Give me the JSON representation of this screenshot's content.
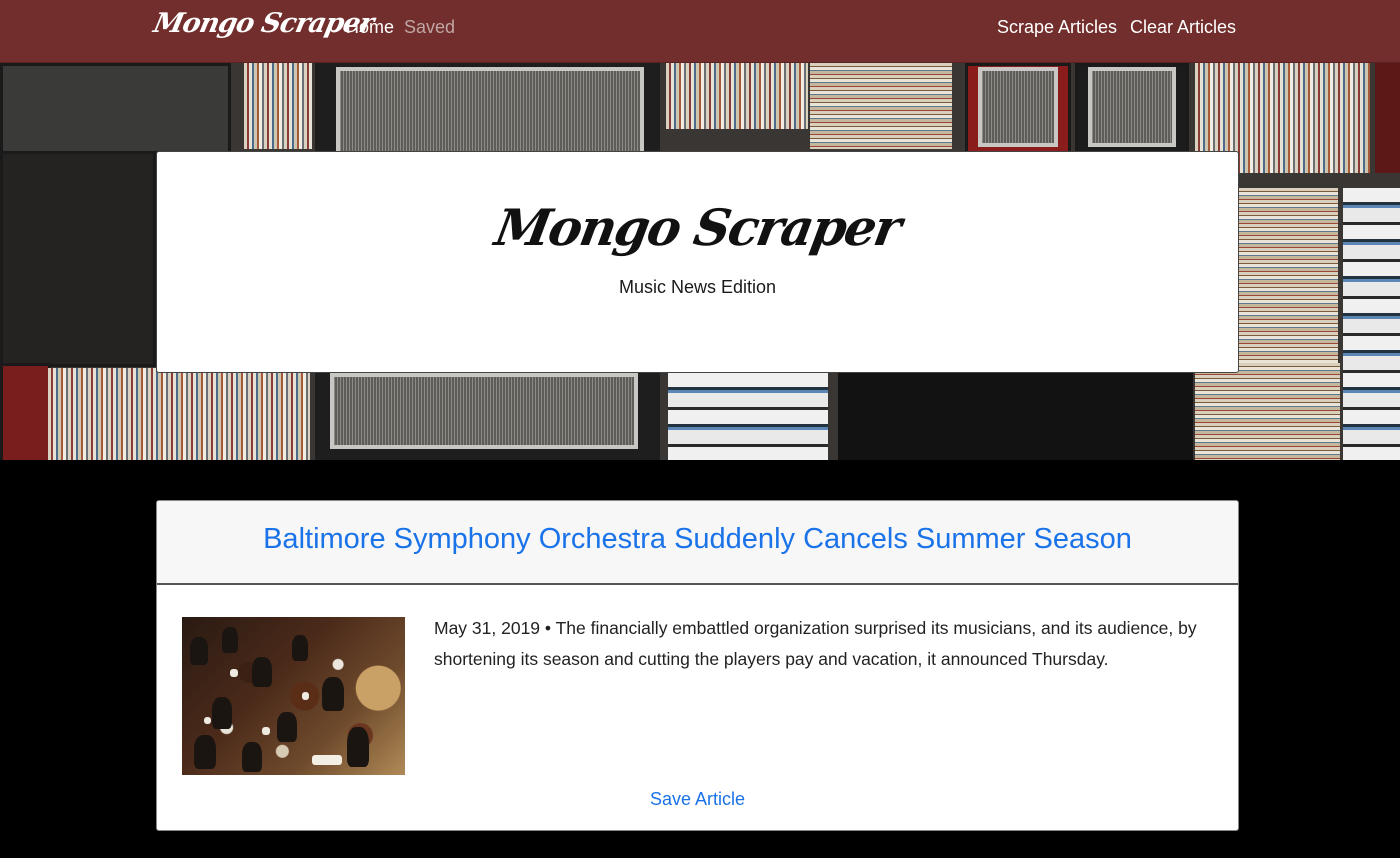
{
  "navbar": {
    "brand": "Mongo Scraper",
    "links": {
      "home": "Home",
      "saved": "Saved",
      "scrape": "Scrape Articles",
      "clear": "Clear Articles"
    }
  },
  "hero": {
    "title": "Mongo Scraper",
    "subtitle": "Music News Edition"
  },
  "article": {
    "title": "Baltimore Symphony Orchestra Suddenly Cancels Summer Season",
    "summary": "May 31, 2019 • The financially embattled organization surprised its musicians, and its audience, by shortening its season and cutting the players pay and vacation, it announced Thursday.",
    "save_label": "Save Article"
  },
  "colors": {
    "navbar": "#722e2c",
    "link": "#1a73e8",
    "page_background": "#000000"
  }
}
